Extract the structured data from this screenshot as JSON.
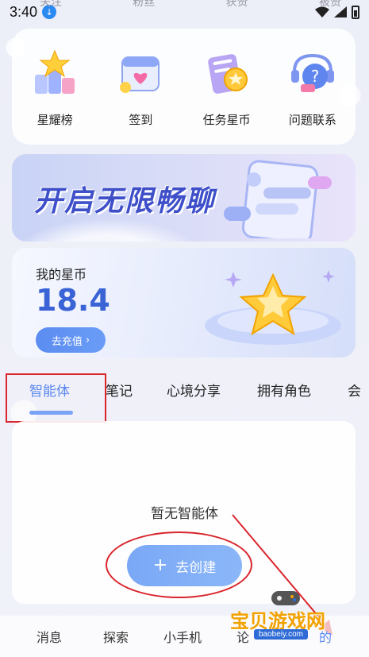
{
  "status_bar": {
    "time": "3:40",
    "faded_tabs": [
      "关注",
      "粉丝",
      "获赞",
      "被赞"
    ]
  },
  "shortcuts": [
    {
      "label": "星耀榜",
      "icon": "trophy-star-icon"
    },
    {
      "label": "签到",
      "icon": "calendar-checkin-icon"
    },
    {
      "label": "任务星币",
      "icon": "task-coin-icon"
    },
    {
      "label": "问题联系",
      "icon": "help-contact-icon"
    }
  ],
  "banner": {
    "title": "开启无限畅聊"
  },
  "coins": {
    "label": "我的星币",
    "value": "18.4",
    "recharge_label": "去充值"
  },
  "tabs": [
    {
      "label": "智能体",
      "active": true
    },
    {
      "label": "笔记",
      "active": false
    },
    {
      "label": "心境分享",
      "active": false
    },
    {
      "label": "拥有角色",
      "active": false
    },
    {
      "label": "会",
      "active": false
    }
  ],
  "content": {
    "empty_text": "暂无智能体",
    "create_label": "去创建",
    "create_icon": "plus-icon"
  },
  "bottom_nav": [
    {
      "label": "消息"
    },
    {
      "label": "探索"
    },
    {
      "label": "小手机"
    },
    {
      "label": "论"
    },
    {
      "label": "的"
    }
  ],
  "watermark": {
    "name": "宝贝游戏网",
    "url": "baobeiy.com"
  },
  "colors": {
    "accent": "#5a87f1",
    "coin_value": "#3a63d6",
    "annotation": "#d9252c"
  }
}
